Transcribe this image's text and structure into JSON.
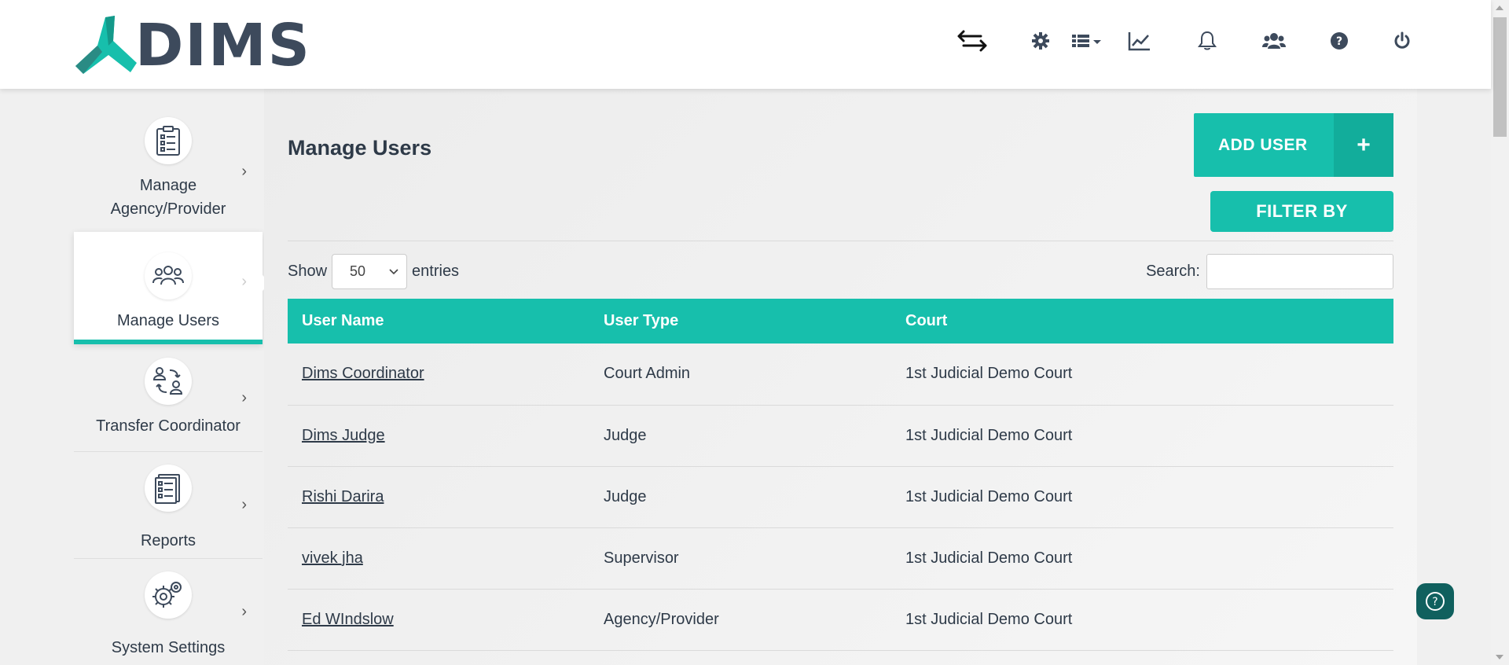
{
  "brand": {
    "name": "DIMS",
    "accent": "#17bfac",
    "accent_dark": "#12ad9b",
    "text": "#2e3a48"
  },
  "header": {
    "icons": [
      "transfer-arrows-icon",
      "gear-icon",
      "list-dropdown-icon",
      "line-chart-icon",
      "bell-icon",
      "users-icon",
      "help-icon",
      "power-icon"
    ]
  },
  "sidebar": {
    "items": [
      {
        "label": "Manage Agency/Provider",
        "icon": "clipboard-list-icon"
      },
      {
        "label": "Manage Users",
        "icon": "users-group-icon",
        "active": true
      },
      {
        "label": "Transfer Coordinator",
        "icon": "user-transfer-icon"
      },
      {
        "label": "Reports",
        "icon": "report-checklist-icon"
      },
      {
        "label": "System Settings",
        "icon": "gears-icon"
      }
    ]
  },
  "main": {
    "title": "Manage Users",
    "add_button": "ADD USER",
    "add_icon": "+",
    "filter_button": "FILTER BY",
    "show_label": "Show",
    "entries_value": "50",
    "entries_label": "entries",
    "search_label": "Search:",
    "search_value": ""
  },
  "table": {
    "columns": [
      "User Name",
      "User Type",
      "Court"
    ],
    "rows": [
      {
        "name": "Dims Coordinator",
        "type": "Court Admin",
        "court": "1st Judicial Demo Court"
      },
      {
        "name": "Dims Judge",
        "type": "Judge",
        "court": "1st Judicial Demo Court"
      },
      {
        "name": "Rishi Darira",
        "type": "Judge",
        "court": "1st Judicial Demo Court"
      },
      {
        "name": "vivek jha",
        "type": "Supervisor",
        "court": "1st Judicial Demo Court"
      },
      {
        "name": "Ed WIndslow",
        "type": "Agency/Provider",
        "court": "1st Judicial Demo Court"
      }
    ]
  }
}
